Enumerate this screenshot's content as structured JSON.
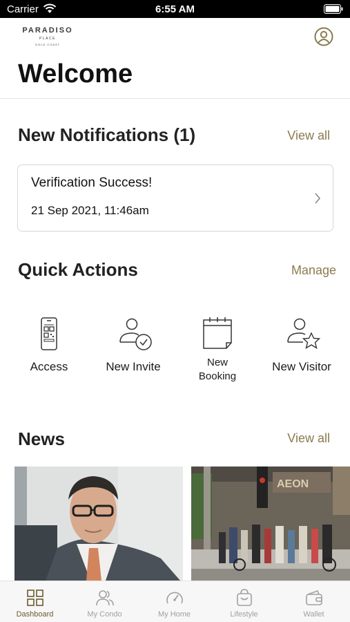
{
  "status_bar": {
    "carrier": "Carrier",
    "time": "6:55 AM"
  },
  "brand": {
    "name": "PARADISO",
    "sub": "PLACE",
    "location": "GOLD COAST"
  },
  "header": {
    "title": "Welcome"
  },
  "notifications": {
    "title": "New Notifications (1)",
    "view_all": "View all",
    "items": [
      {
        "title": "Verification Success!",
        "date": "21 Sep 2021, 11:46am"
      }
    ]
  },
  "quick_actions": {
    "title": "Quick Actions",
    "manage": "Manage",
    "items": [
      {
        "label": "Access",
        "icon": "qr-phone-icon"
      },
      {
        "label": "New Invite",
        "icon": "user-check-icon"
      },
      {
        "label": "New\nBooking",
        "icon": "calendar-icon"
      },
      {
        "label": "New Visitor",
        "icon": "user-star-icon"
      }
    ]
  },
  "news": {
    "title": "News",
    "view_all": "View all"
  },
  "tab_bar": {
    "items": [
      {
        "label": "Dashboard",
        "icon": "grid-icon",
        "active": true
      },
      {
        "label": "My Condo",
        "icon": "users-icon",
        "active": false
      },
      {
        "label": "My Home",
        "icon": "gauge-icon",
        "active": false
      },
      {
        "label": "Lifestyle",
        "icon": "basket-icon",
        "active": false
      },
      {
        "label": "Wallet",
        "icon": "wallet-icon",
        "active": false
      }
    ]
  },
  "colors": {
    "accent": "#8b7a4e",
    "active_tab": "#6b5a2f",
    "inactive_tab": "#a0a0a0"
  }
}
